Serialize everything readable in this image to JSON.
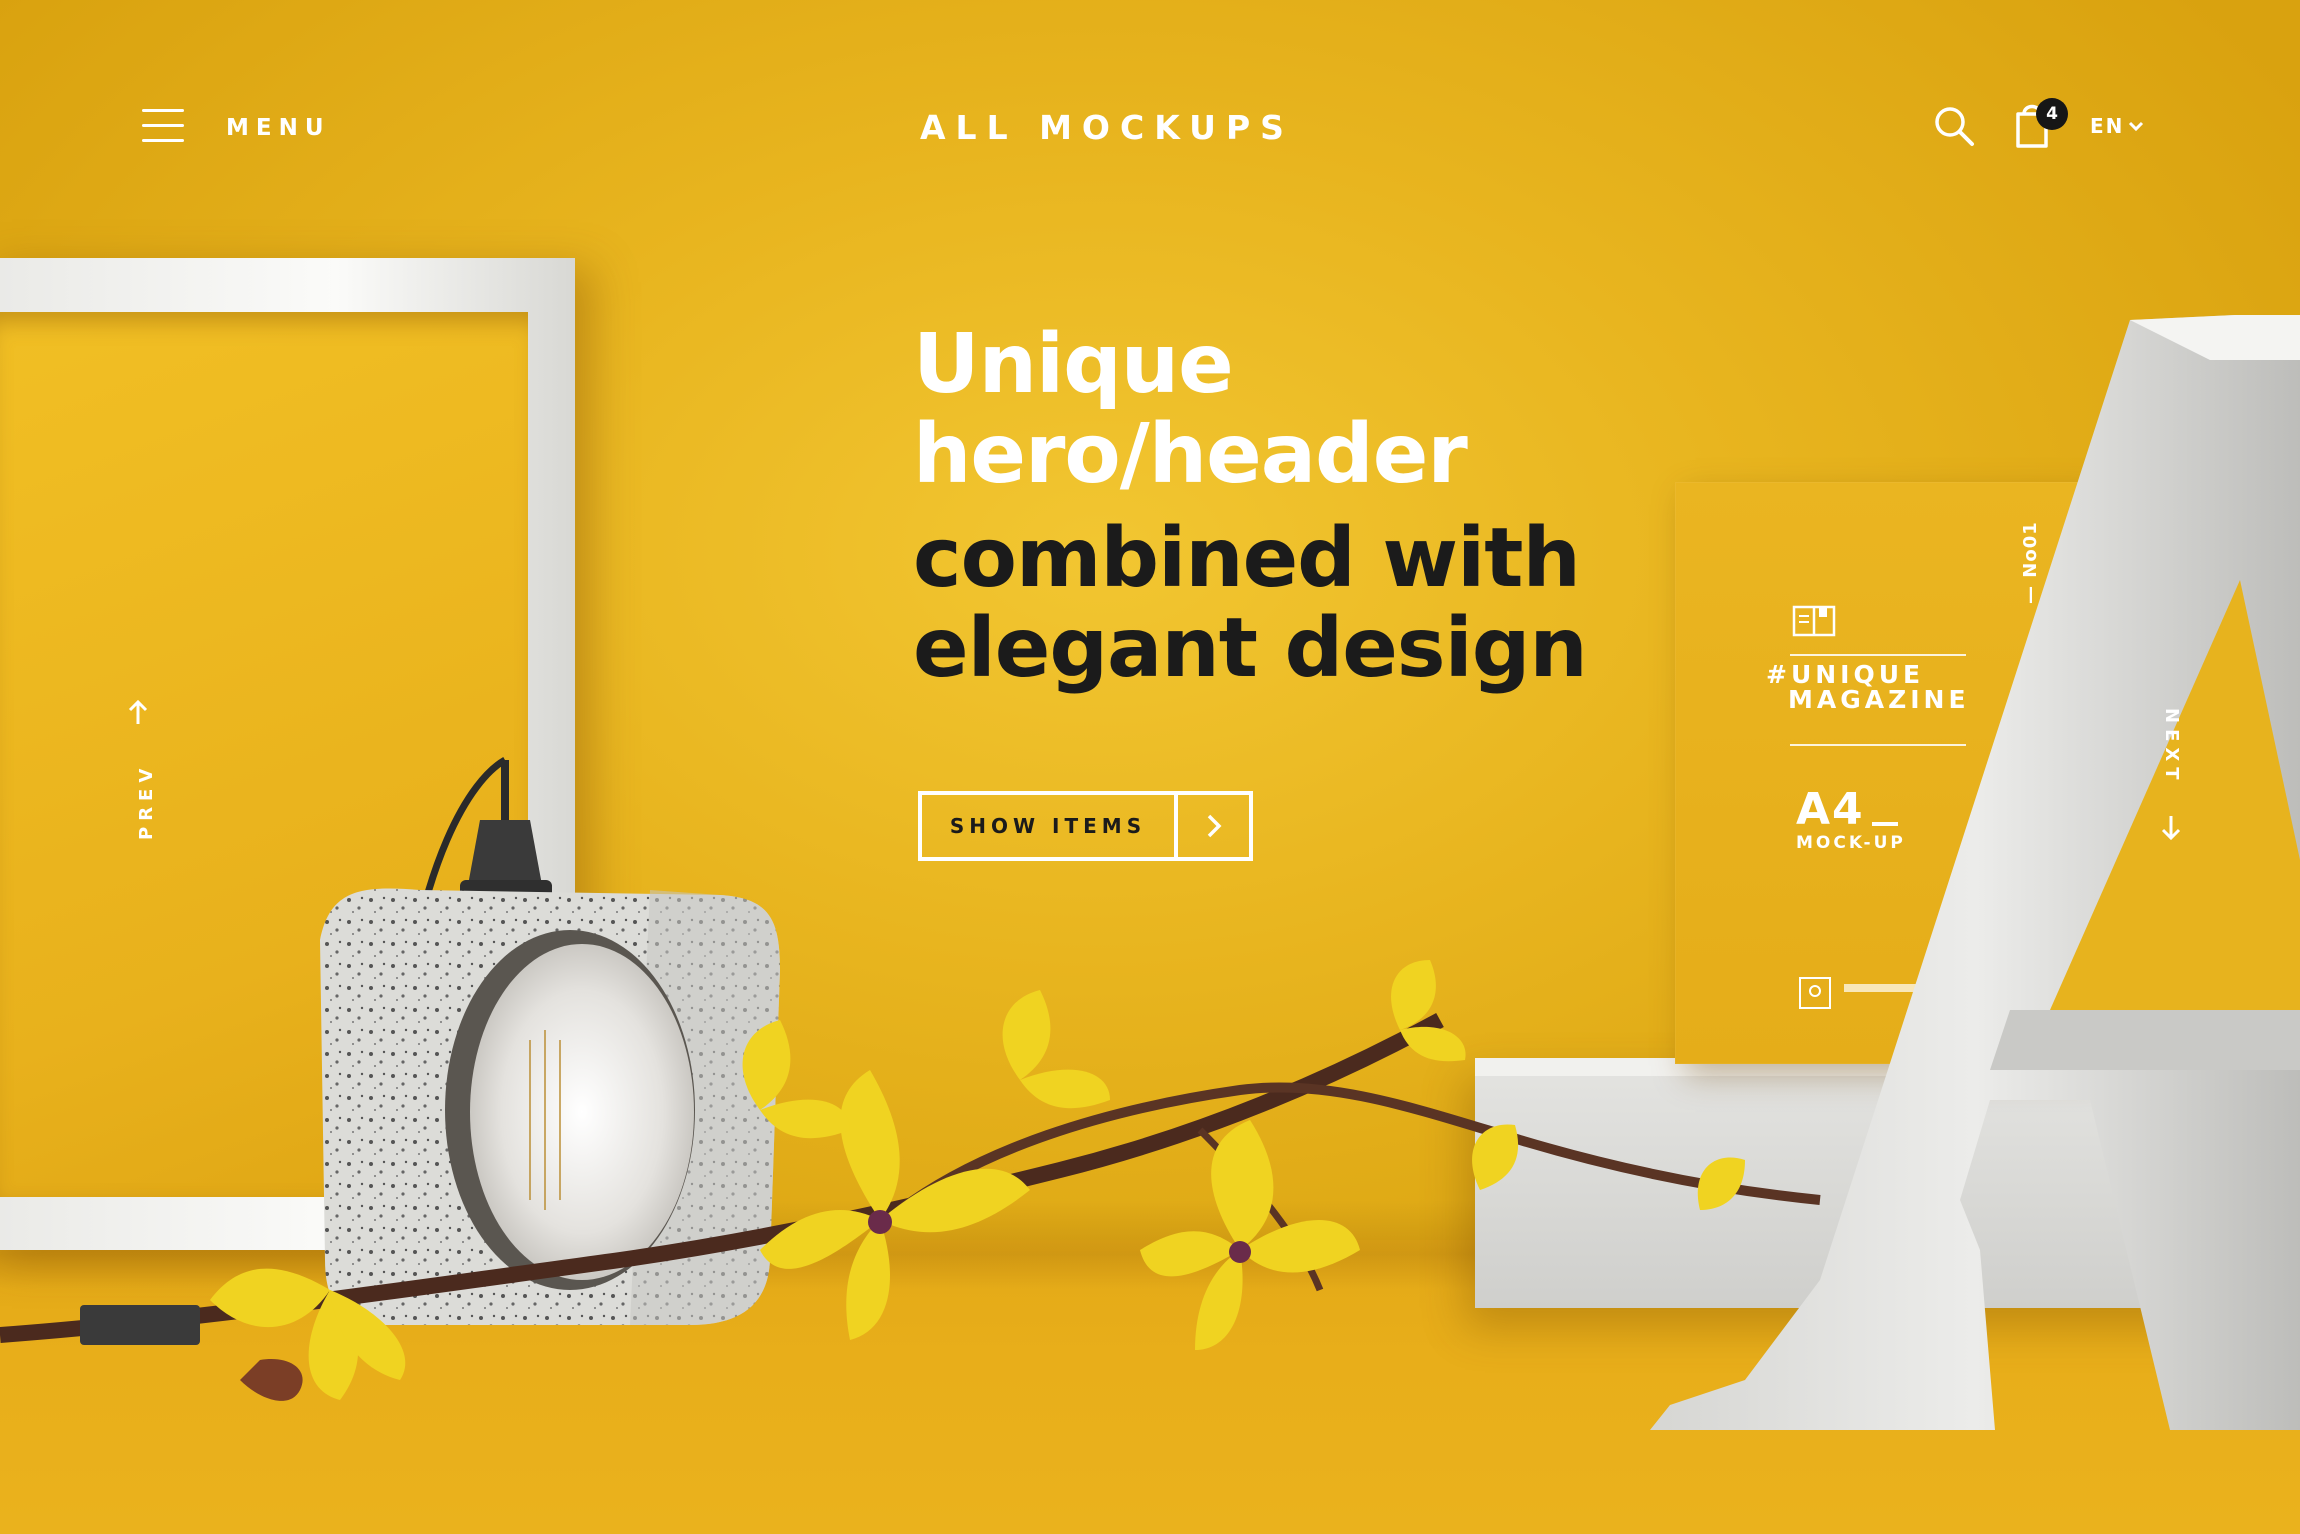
{
  "header": {
    "menu_label": "MENU",
    "brand": "ALL MOCKUPS",
    "cart_count": "4",
    "language": "EN"
  },
  "hero": {
    "line1": "Unique",
    "line2": "hero/header",
    "line3": "combined with",
    "line4": "elegant design",
    "cta_label": "SHOW ITEMS"
  },
  "nav": {
    "prev_label": "PREV",
    "next_label": "NEXT"
  },
  "magazine": {
    "issue": "— No01",
    "title_line1": "#UNIQUE",
    "title_line2": "MAGAZINE",
    "format": "A4",
    "subtitle": "MOCK-UP"
  },
  "icons": {
    "menu": "hamburger-icon",
    "search": "search-icon",
    "cart": "shopping-bag-icon",
    "language_caret": "chevron-down-icon",
    "cta_arrow": "chevron-right-icon",
    "prev": "arrow-up-icon",
    "next": "arrow-down-icon"
  },
  "colors": {
    "background": "#e8b51f",
    "accent_dark": "#1b1b1b",
    "text_light": "#ffffff"
  }
}
